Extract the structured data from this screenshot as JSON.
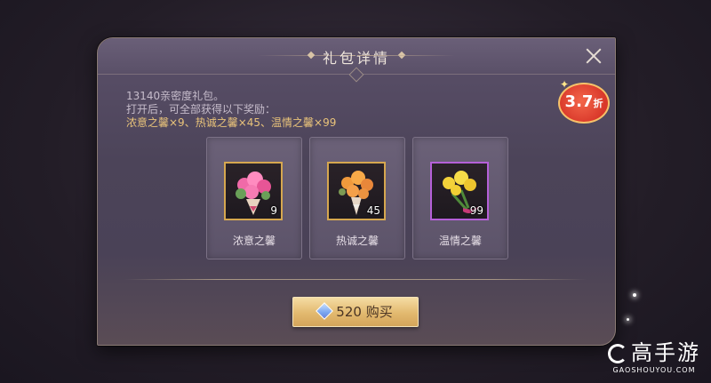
{
  "dialog": {
    "title": "礼包详情",
    "description_line1": "13140亲密度礼包。",
    "description_line2": "打开后，可全部获得以下奖励：",
    "description_rewards": "浓意之馨×9、热诚之馨×45、温情之馨×99",
    "discount_value": "3.7",
    "discount_suffix": "折",
    "items": [
      {
        "name": "浓意之馨",
        "count": "9",
        "icon": "pink-bouquet-icon",
        "rarity_color": "#d6a74f"
      },
      {
        "name": "热诚之馨",
        "count": "45",
        "icon": "orange-bouquet-icon",
        "rarity_color": "#d6a74f"
      },
      {
        "name": "温情之馨",
        "count": "99",
        "icon": "yellow-bouquet-icon",
        "rarity_color": "#b560d8"
      }
    ],
    "buy_button": {
      "price": "520",
      "label": "购买",
      "currency_icon": "diamond-icon"
    }
  },
  "watermark": {
    "brand": "高手游",
    "site": "GAOSHOUYOU.COM"
  }
}
